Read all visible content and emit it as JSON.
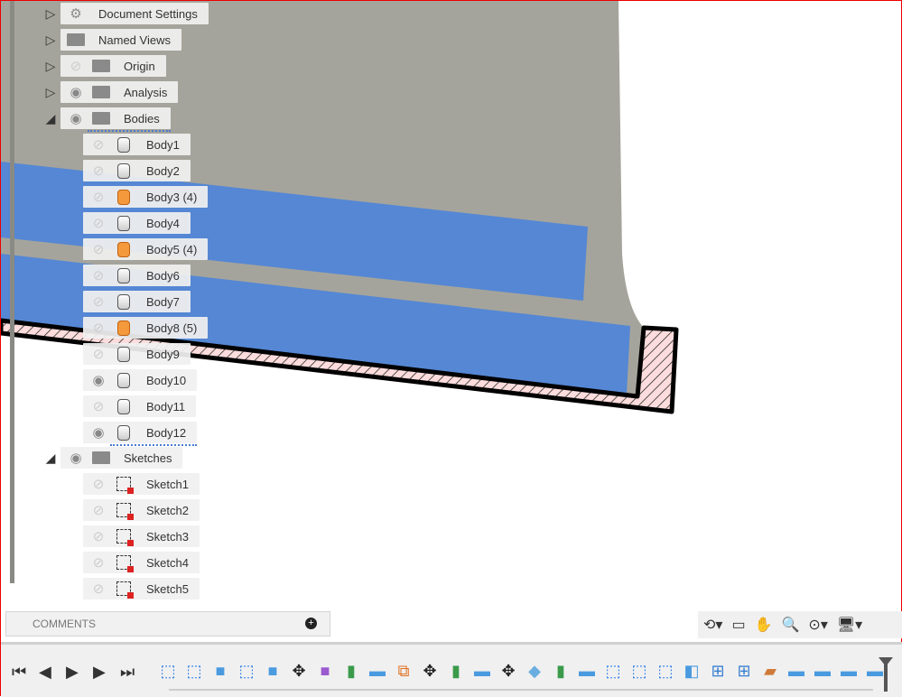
{
  "browser": {
    "items": [
      {
        "label": "Document Settings",
        "icon": "gear-icon",
        "expand": "collapsed",
        "eye": null
      },
      {
        "label": "Named Views",
        "icon": "folder-icon",
        "expand": "collapsed",
        "eye": null
      },
      {
        "label": "Origin",
        "icon": "folder-icon",
        "expand": "collapsed",
        "eye": "hidden"
      },
      {
        "label": "Analysis",
        "icon": "folder-icon",
        "expand": "collapsed",
        "eye": "visible"
      },
      {
        "label": "Bodies",
        "icon": "folder-icon",
        "expand": "expanded",
        "eye": "visible"
      }
    ],
    "bodies": [
      {
        "label": "Body1",
        "eye": "hidden",
        "type": "body"
      },
      {
        "label": "Body2",
        "eye": "hidden",
        "type": "body"
      },
      {
        "label": "Body3 (4)",
        "eye": "hidden",
        "type": "component"
      },
      {
        "label": "Body4",
        "eye": "hidden",
        "type": "body"
      },
      {
        "label": "Body5 (4)",
        "eye": "hidden",
        "type": "component"
      },
      {
        "label": "Body6",
        "eye": "hidden",
        "type": "body"
      },
      {
        "label": "Body7",
        "eye": "hidden",
        "type": "body"
      },
      {
        "label": "Body8 (5)",
        "eye": "hidden",
        "type": "component"
      },
      {
        "label": "Body9",
        "eye": "hidden",
        "type": "body"
      },
      {
        "label": "Body10",
        "eye": "visible",
        "type": "body"
      },
      {
        "label": "Body11",
        "eye": "hidden",
        "type": "body"
      },
      {
        "label": "Body12",
        "eye": "visible",
        "type": "body"
      }
    ],
    "sketches_folder": {
      "label": "Sketches",
      "eye": "visible"
    },
    "sketches": [
      "Sketch1",
      "Sketch2",
      "Sketch3",
      "Sketch4",
      "Sketch5"
    ]
  },
  "comments": {
    "label": "COMMENTS"
  },
  "nav_icons": [
    "orbit-icon",
    "look-at-icon",
    "pan-icon",
    "zoom-icon",
    "fit-icon",
    "display-settings-icon"
  ],
  "timeline": {
    "features": [
      "sketch",
      "sketch",
      "extrude",
      "sketch",
      "extrude",
      "move",
      "box",
      "split",
      "plane",
      "combine",
      "move",
      "split",
      "plane",
      "move",
      "shell",
      "split",
      "plane",
      "sketch",
      "sketch",
      "sketch",
      "box-cut",
      "joint",
      "joint",
      "eraser",
      "plane",
      "plane",
      "plane",
      "plane"
    ]
  },
  "colors": {
    "body_gray": "#a5a49c",
    "selection_blue": "#5587d4",
    "section_hatch": "#fbd8d8"
  }
}
